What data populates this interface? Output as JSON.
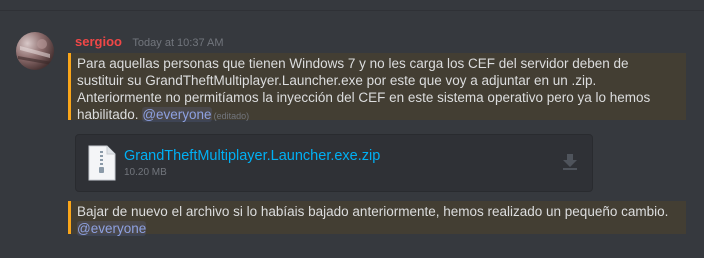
{
  "message": {
    "author": "sergioo",
    "timestamp": "Today at 10:37 AM",
    "lines": [
      "Para aquellas personas que tienen Windows 7 y no les carga los CEF del servidor deben de",
      "sustituir su GrandTheftMultiplayer.Launcher.exe por este que voy a adjuntar en un .zip.",
      "Anteriormente no permitíamos la inyección del CEF en este sistema operativo pero ya lo hemos",
      "habilitado."
    ],
    "mention": "@everyone",
    "edited_label": "(editado)"
  },
  "attachment": {
    "file_name": "GrandTheftMultiplayer.Launcher.exe.zip",
    "file_size": "10.20 MB"
  },
  "followup": {
    "text": "Bajar de nuevo el archivo si lo habíais bajado anteriormente, hemos realizado un pequeño cambio.",
    "mention": "@everyone"
  },
  "colors": {
    "background": "#36393e",
    "username": "#f04747",
    "mention_highlight_border": "#faa61a",
    "mention_highlight_bg": "#433e33",
    "mention_text": "#8ea1e1",
    "link": "#00b0f4"
  },
  "icons": {
    "file": "file-icon",
    "download": "download-icon"
  }
}
